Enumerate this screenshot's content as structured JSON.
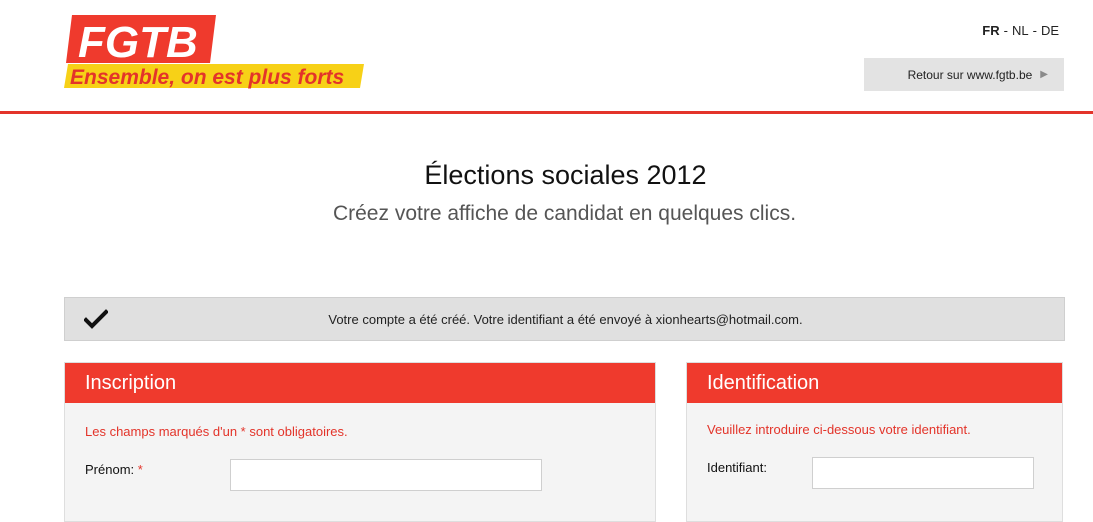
{
  "header": {
    "logo_text": "FGTB",
    "logo_tagline": "Ensemble, on est plus forts",
    "languages": [
      "FR",
      "NL",
      "DE"
    ],
    "active_language": "FR",
    "back_link": "Retour sur www.fgtb.be"
  },
  "main": {
    "title": "Élections sociales 2012",
    "subtitle": "Créez votre affiche de candidat en quelques clics."
  },
  "notice": {
    "icon": "check-icon",
    "text": "Votre compte a été créé. Votre identifiant a été envoyé à xionhearts@hotmail.com."
  },
  "inscription": {
    "title": "Inscription",
    "required_note": "Les champs marqués d'un * sont obligatoires.",
    "prenom_label": "Prénom:",
    "prenom_required_mark": "*",
    "prenom_value": ""
  },
  "identification": {
    "title": "Identification",
    "instruction": "Veuillez introduire ci-dessous votre identifiant.",
    "identifiant_label": "Identifiant:",
    "identifiant_value": ""
  },
  "colors": {
    "brand_red": "#ef3a2d",
    "tagline_yellow": "#f7d117",
    "panel_bg": "#f4f4f4",
    "notice_bg": "#e0e0e0"
  }
}
